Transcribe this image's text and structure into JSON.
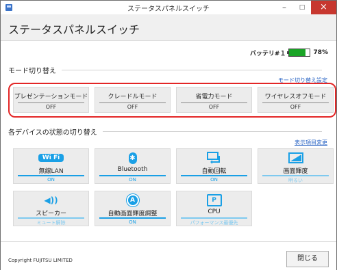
{
  "window": {
    "title": "ステータスパネルスイッチ",
    "minimize": "–",
    "maximize": "□",
    "close": "×"
  },
  "header": {
    "title": "ステータスパネルスイッチ"
  },
  "battery": {
    "label": "バッテリ#１",
    "percent_text": "78%",
    "level": 0.78
  },
  "mode_section": {
    "title": "モード切り替え",
    "settings_link": "モード切り替え設定",
    "modes": [
      {
        "label": "プレゼンテーションモード",
        "value": "OFF"
      },
      {
        "label": "クレードルモード",
        "value": "OFF"
      },
      {
        "label": "省電力モード",
        "value": "OFF"
      },
      {
        "label": "ワイヤレスオフモード",
        "value": "OFF"
      }
    ]
  },
  "device_section": {
    "title": "各デバイスの状態の切り替え",
    "display_link": "表示項目変更",
    "devices": [
      {
        "label": "無線LAN",
        "value": "ON",
        "icon": "wifi-icon",
        "icon_text": "Wi Fi"
      },
      {
        "label": "Bluetooth",
        "value": "ON",
        "icon": "bluetooth-icon",
        "icon_text": "✱"
      },
      {
        "label": "自動回転",
        "value": "ON",
        "icon": "auto-rotate-icon",
        "icon_text": ""
      },
      {
        "label": "画面輝度",
        "value": "明るい",
        "icon": "brightness-icon",
        "icon_text": ""
      },
      {
        "label": "スピーカー",
        "value": "ミュート解除",
        "icon": "speaker-icon",
        "icon_text": "◀))"
      },
      {
        "label": "自動画面輝度調整",
        "value": "ON",
        "icon": "auto-brightness-icon",
        "icon_text": "A"
      },
      {
        "label": "CPU",
        "value": "パフォーマンス最優先",
        "icon": "cpu-icon",
        "icon_text": "P"
      }
    ]
  },
  "footer": {
    "copyright": "Copyright FUJITSU LIMITED",
    "close_button": "閉じる"
  },
  "colors": {
    "accent": "#1aa0e6",
    "red_frame": "#e32626",
    "link": "#2a64c4",
    "battery": "#1aa526"
  }
}
